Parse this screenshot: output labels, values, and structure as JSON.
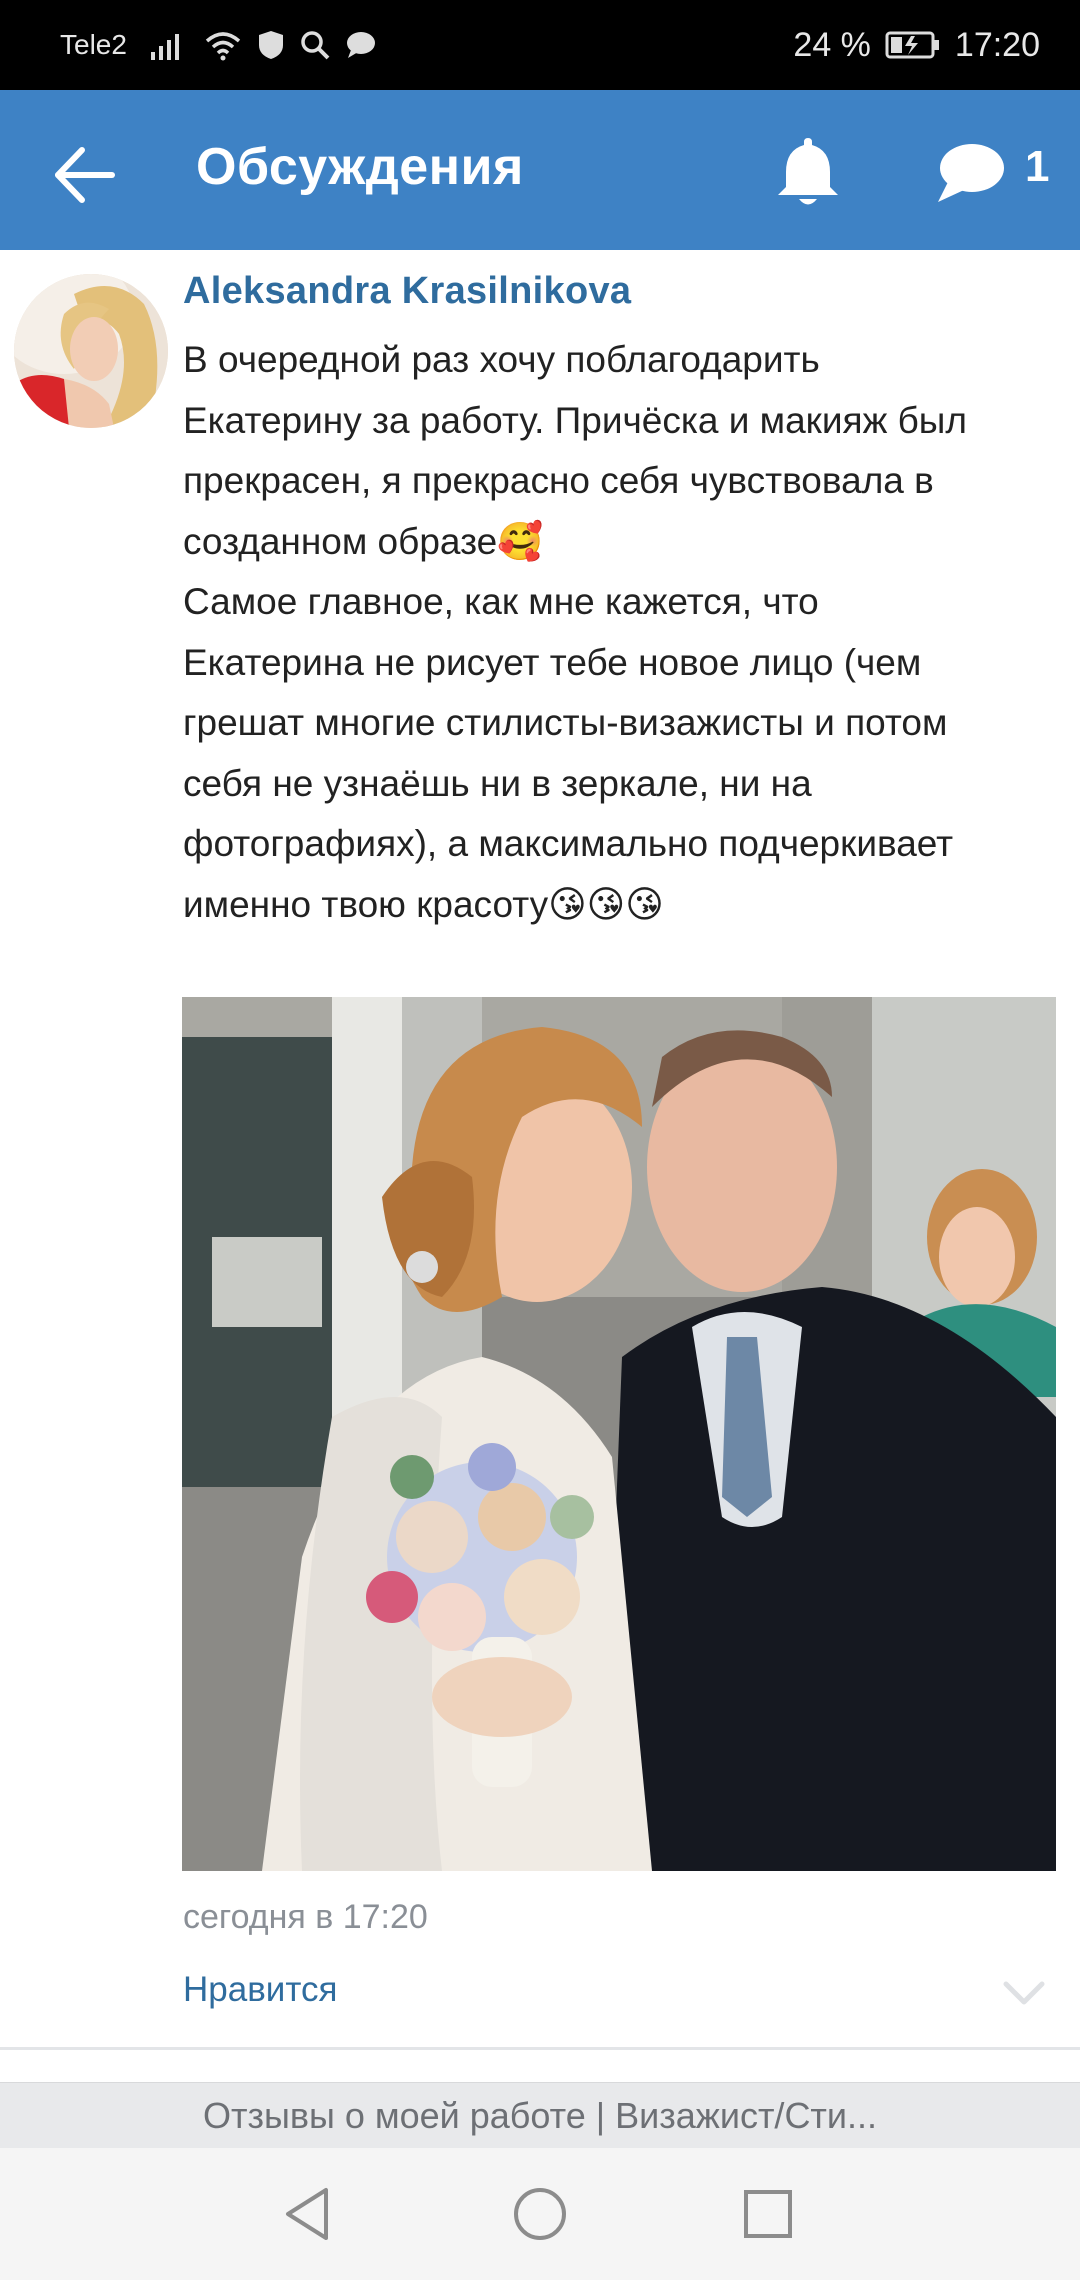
{
  "status_bar": {
    "carrier": "Tele2",
    "battery": "24 %",
    "time": "17:20"
  },
  "app_bar": {
    "title": "Обсуждения",
    "message_count": "1",
    "icons": [
      "back-arrow-icon",
      "bell-icon",
      "chat-bubble-icon"
    ]
  },
  "post": {
    "author": "Aleksandra Krasilnikova",
    "text_lines": [
      "В очередной раз хочу поблагодарить",
      "Екатерину за работу. Причёска и макияж был",
      "прекрасен, я прекрасно себя чувствовала в",
      "созданном образе🥰",
      "Самое главное, как мне кажется, что",
      "Екатерина не рисует тебе новое лицо (чем",
      "грешат многие стилисты-визажисты и потом",
      "себя не узнаёшь ни в зеркале, ни на",
      "фотографиях), а максимально подчеркивает",
      "именно твою красоту😘😘😘"
    ],
    "timestamp": "сегодня в 17:20",
    "like_label": "Нравится"
  },
  "bottom_title": "Отзывы о моей работе | Визажист/Сти...",
  "colors": {
    "app_bar": "#3e82c5",
    "link": "#2f6c9e",
    "status_bar": "#000000"
  }
}
